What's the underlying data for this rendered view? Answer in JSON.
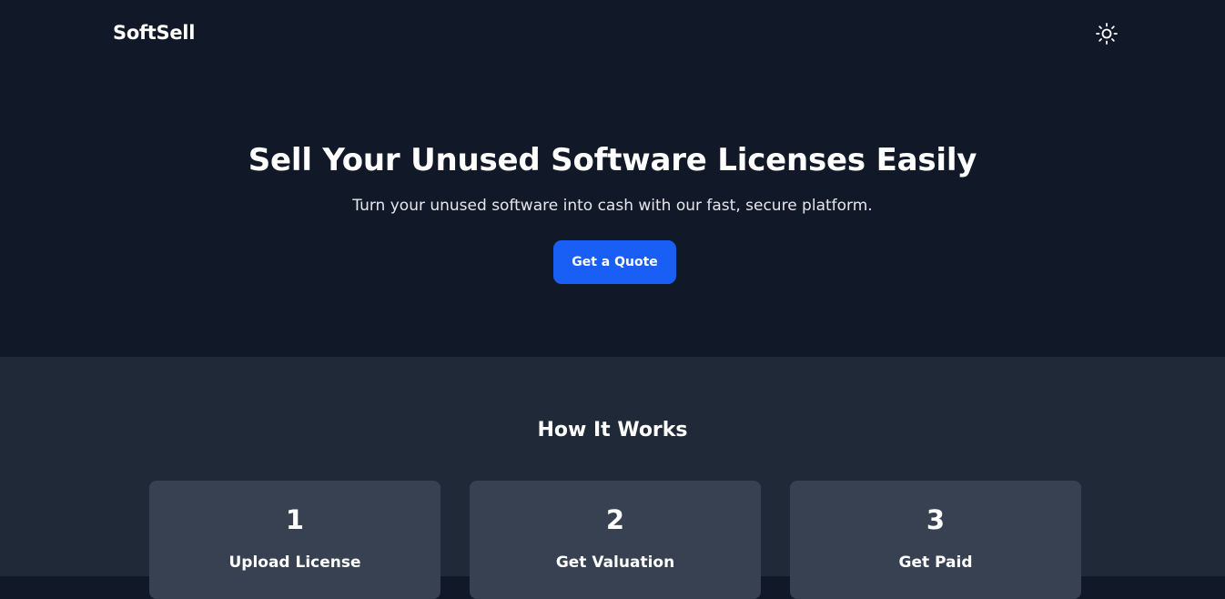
{
  "header": {
    "logo": "SoftSell",
    "theme_toggle_icon": "sun-icon"
  },
  "hero": {
    "title": "Sell Your Unused Software Licenses Easily",
    "subtitle": "Turn your unused software into cash with our fast, secure platform.",
    "cta_label": "Get a Quote"
  },
  "how_it_works": {
    "title": "How It Works",
    "steps": [
      {
        "number": "1",
        "label": "Upload License"
      },
      {
        "number": "2",
        "label": "Get Valuation"
      },
      {
        "number": "3",
        "label": "Get Paid"
      }
    ]
  },
  "colors": {
    "hero_bg": "#111827",
    "section_bg": "#1f2937",
    "card_bg": "#374151",
    "accent": "#1a5ff5"
  }
}
